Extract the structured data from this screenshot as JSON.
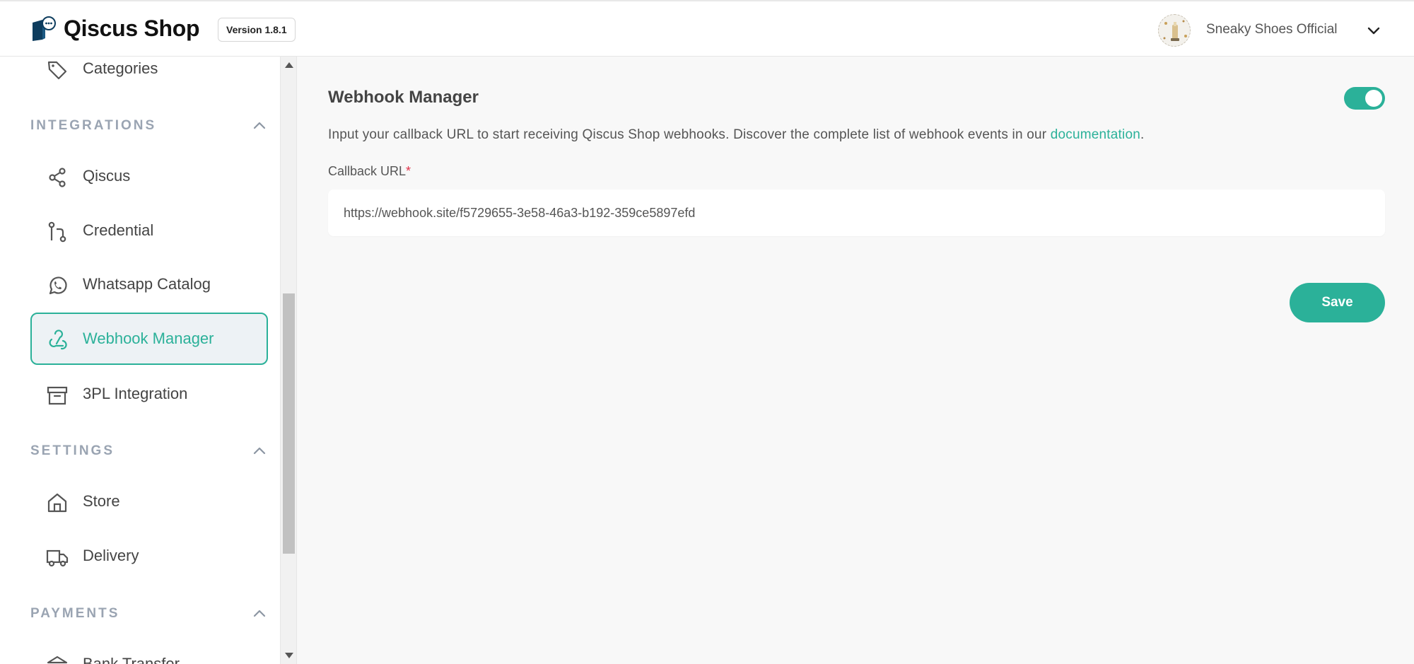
{
  "header": {
    "app_name": "Qiscus Shop",
    "version": "Version 1.8.1",
    "store_name": "Sneaky Shoes Official"
  },
  "sidebar": {
    "items_top": [
      {
        "label": "Categories",
        "icon": "tag-icon"
      }
    ],
    "sections": {
      "integrations": {
        "title": "INTEGRATIONS",
        "items": [
          {
            "label": "Qiscus",
            "icon": "share-icon"
          },
          {
            "label": "Credential",
            "icon": "git-compare-icon"
          },
          {
            "label": "Whatsapp Catalog",
            "icon": "whatsapp-icon"
          },
          {
            "label": "Webhook Manager",
            "icon": "webhook-icon",
            "active": true
          },
          {
            "label": "3PL Integration",
            "icon": "archive-icon"
          }
        ]
      },
      "settings": {
        "title": "SETTINGS",
        "items": [
          {
            "label": "Store",
            "icon": "home-icon"
          },
          {
            "label": "Delivery",
            "icon": "truck-icon"
          }
        ]
      },
      "payments": {
        "title": "PAYMENTS",
        "items": [
          {
            "label": "Bank Transfer",
            "icon": "bank-icon"
          }
        ]
      }
    }
  },
  "main": {
    "title": "Webhook Manager",
    "toggle_enabled": true,
    "description_prefix": "Input your callback URL to start receiving Qiscus Shop webhooks. Discover the complete list of webhook events in our ",
    "description_link": "documentation",
    "description_suffix": ".",
    "field_label": "Callback URL",
    "required_mark": "*",
    "callback_url": "https://webhook.site/f5729655-3e58-46a3-b192-359ce5897efd",
    "save_label": "Save"
  },
  "colors": {
    "accent": "#2bb199",
    "active_bg": "#edf2f5",
    "section_title": "#9aa4b2",
    "required": "#e0334a"
  }
}
